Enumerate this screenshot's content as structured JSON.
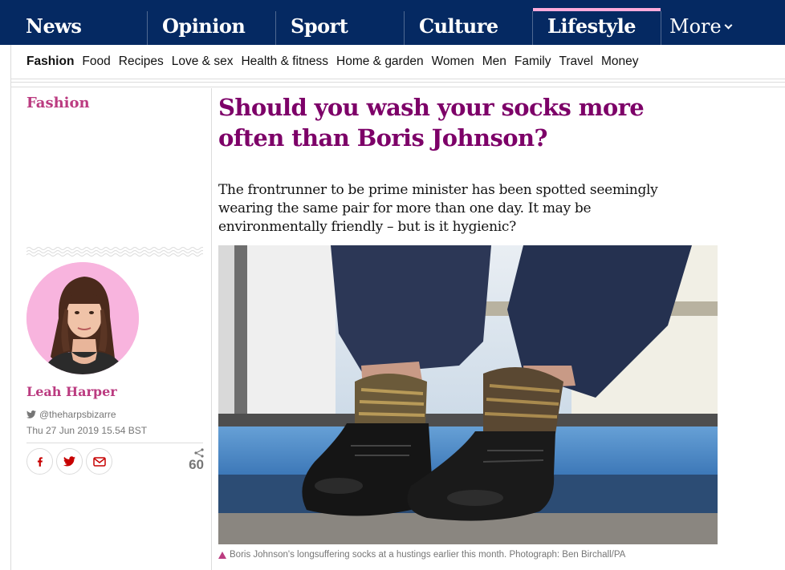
{
  "colors": {
    "nav_bg": "#052962",
    "lifestyle_accent": "#ffabdb",
    "lifestyle_text": "#bb3b80",
    "headline": "#7d0068"
  },
  "pillars": [
    {
      "label": "News"
    },
    {
      "label": "Opinion"
    },
    {
      "label": "Sport"
    },
    {
      "label": "Culture"
    },
    {
      "label": "Lifestyle",
      "active": true
    }
  ],
  "more_label": "More",
  "subnav": [
    "Fashion",
    "Food",
    "Recipes",
    "Love & sex",
    "Health & fitness",
    "Home & garden",
    "Women",
    "Men",
    "Family",
    "Travel",
    "Money"
  ],
  "article": {
    "section": "Fashion",
    "headline": "Should you wash your socks more often than Boris Johnson?",
    "standfirst": "The frontrunner to be prime minister has been spotted seemingly wearing the same pair for more than one day. It may be environmentally friendly – but is it hygienic?",
    "author": {
      "name": "Leah Harper",
      "twitter": "@theharpsbizarre"
    },
    "date": "Thu 27 Jun 2019 15.54 BST",
    "share_count": "60",
    "share_icons": [
      "facebook-icon",
      "twitter-icon",
      "email-icon"
    ],
    "caption": "Boris Johnson's longsuffering socks at a hustings earlier this month. Photograph: Ben Birchall/PA"
  }
}
